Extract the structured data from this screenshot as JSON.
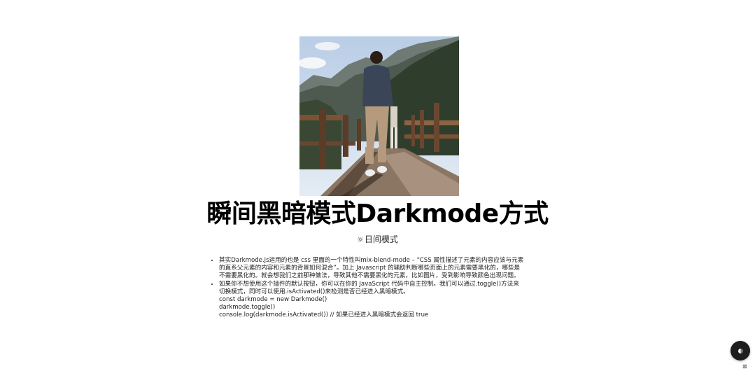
{
  "hero": {
    "image_alt": "瞬间黑暗模式"
  },
  "title": "瞬间黑暗模式Darkmode方式",
  "mode": {
    "icon": "sun-icon",
    "label": "日间模式"
  },
  "content": {
    "items": [
      {
        "lines": [
          "其实Darkmode.js运用的也是 css 里面的一个特性叫mix-blend-mode – “CSS 属性描述了元素的内容应该与元素",
          "的直系父元素的内容和元素的背景如何混合”。加上 Javascript 的辅助判断哪些页面上的元素需要黑化的，哪些是",
          "不需要黑化的。就会想我们之前那种做法，导致其他不需要黑化的元素，比如图片，受到影响导致颜色出现问题。"
        ]
      },
      {
        "lines": [
          "如果你不想使用这个插件的默认按钮，你可以在你的 JavaScript 代码中自主控制。我们可以通过.toggle()方法来",
          "切换模式，同时可以使用.isActivated()来检测是否已经进入黑暗模式。",
          "const darkmode = new Darkmode()",
          "darkmode.toggle()",
          "console.log(darkmode.isActivated()) // 如果已经进入黑暗模式会返回 true"
        ]
      }
    ]
  },
  "toggle_button": {
    "icon": "half-circle-icon"
  },
  "corner_mark": "⊠"
}
